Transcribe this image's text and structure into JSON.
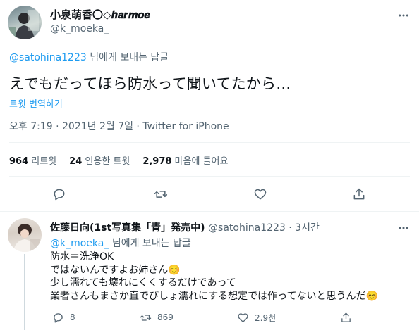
{
  "tweet": {
    "author": {
      "display_name": "小泉萌香〇◇𝒉𝒂𝒓𝒎𝒐𝒆",
      "handle": "@k_moeka_"
    },
    "reply_to_prefix": "@satohina1223",
    "reply_to_suffix": " 님에게 보내는 답글",
    "text": "えでもだってほら防水って聞いてたから…",
    "translate_label": "트윗 번역하기",
    "meta": "오후 7:19 · 2021년 2월 7일 · Twitter for iPhone",
    "stats": {
      "retweets_count": "964",
      "retweets_label": " 리트윗",
      "quotes_count": "24",
      "quotes_label": " 인용한 트윗",
      "likes_count": "2,978",
      "likes_label": " 마음에 들어요"
    }
  },
  "reply": {
    "author": {
      "display_name": "佐藤日向(1st写真集「青」発売中)",
      "handle": "@satohina1223",
      "time": "· 3시간"
    },
    "reply_to_prefix": "@k_moeka_",
    "reply_to_suffix": " 님에게 보내는 답글",
    "lines": [
      "防水＝洗浄OK",
      "ではないんですよお姉さん☺️",
      "少し濡れても壊れにくくするだけであって",
      "業者さんもまさか直でびしょ濡れにする想定では作ってないと思うんだ☺️"
    ],
    "counts": {
      "replies": "8",
      "retweets": "869",
      "likes": "2.9천"
    }
  },
  "colors": {
    "accent": "#1d9bf0",
    "muted": "#536471",
    "border": "#eff3f4"
  },
  "icons": [
    "more-icon",
    "reply-icon",
    "retweet-icon",
    "like-icon",
    "share-icon"
  ]
}
